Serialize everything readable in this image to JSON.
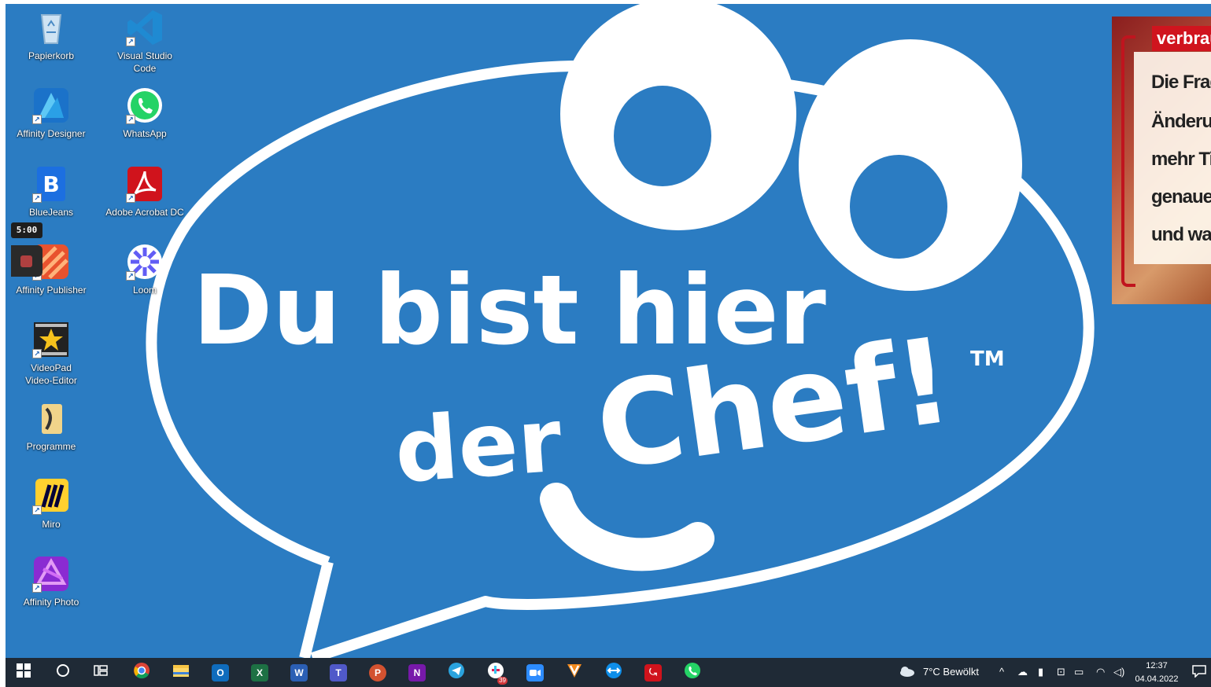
{
  "desktop": {
    "icons": [
      {
        "label": "Papierkorb",
        "icon": "recycle-bin-icon"
      },
      {
        "label": "Visual Studio Code",
        "icon": "vscode-icon"
      },
      {
        "label": "Affinity Designer",
        "icon": "affinity-designer-icon"
      },
      {
        "label": "WhatsApp",
        "icon": "whatsapp-icon"
      },
      {
        "label": "BlueJeans",
        "icon": "bluejeans-icon"
      },
      {
        "label": "Adobe Acrobat DC",
        "icon": "acrobat-icon"
      },
      {
        "label": "Affinity Publisher",
        "icon": "affinity-publisher-icon"
      },
      {
        "label": "Loom",
        "icon": "loom-icon"
      },
      {
        "label": "VideoPad\nVideo-Editor",
        "icon": "videopad-icon"
      },
      {
        "label": "Programme",
        "icon": "programs-folder-icon"
      },
      {
        "label": "Miro",
        "icon": "miro-icon"
      },
      {
        "label": "Affinity Photo",
        "icon": "affinity-photo-icon"
      }
    ]
  },
  "wallpaper": {
    "line1": "Du bist hier",
    "line2": "der",
    "line3": "Chef!",
    "trademark": "TM",
    "background_color": "#2b7cc2"
  },
  "timer": {
    "value": "5:00"
  },
  "video_overlay": {
    "tag": "verbrauc",
    "lines": [
      "Die Fragel",
      "Änderung",
      "mehr Tier",
      "genauer, v",
      "und was s"
    ]
  },
  "taskbar": {
    "apps": [
      "start-icon",
      "search-icon",
      "task-view-icon",
      "chrome-icon",
      "file-explorer-icon",
      "outlook-icon",
      "excel-icon",
      "word-icon",
      "teams-icon",
      "powerpoint-icon",
      "onenote-icon",
      "telegram-icon",
      "slack-icon",
      "zoom-icon",
      "vivaldi-icon",
      "teamviewer-icon",
      "acrobat-icon",
      "whatsapp-icon"
    ],
    "slack_badge": "39",
    "weather": "7°C  Bewölkt",
    "time": "12:37",
    "date": "04.04.2022"
  }
}
